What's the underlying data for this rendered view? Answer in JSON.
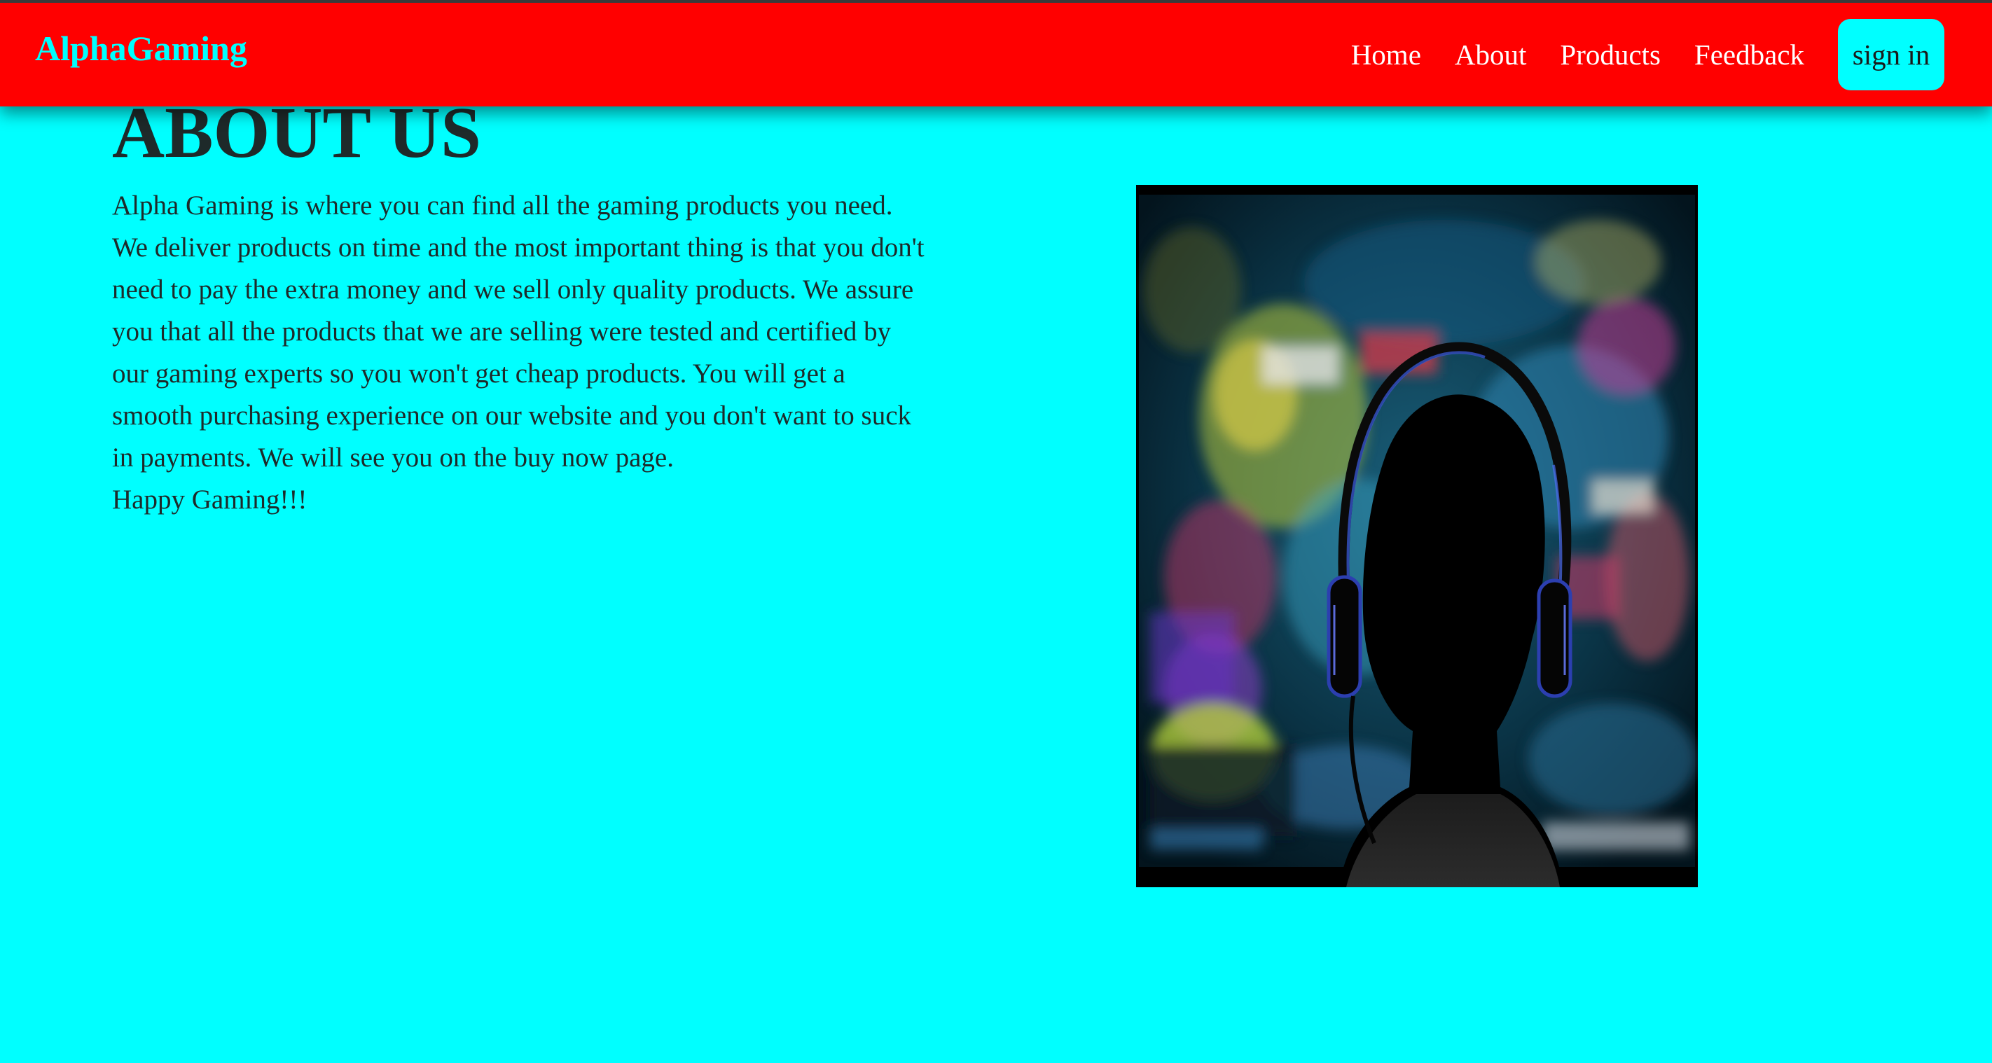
{
  "navbar": {
    "brand": "AlphaGaming",
    "links": [
      "Home",
      "About",
      "Products",
      "Feedback"
    ],
    "signin_label": "sign in"
  },
  "about": {
    "title": "ABOUT US",
    "paragraph": "Alpha Gaming is where you can find all the gaming products you need. We deliver products on time and the most important thing is that you don't need to pay the extra money and we sell only quality products. We assure you that all the products that we are selling were tested and certified by our gaming experts so you won't get cheap products. You will get a smooth purchasing experience on our website and you don't want to suck in payments. We will see you on the buy now page.",
    "closing": "Happy Gaming!!!"
  },
  "image": {
    "subject": "gamer with headphones in front of a blurred game screen"
  },
  "colors": {
    "navbar_bg": "#ff0000",
    "page_bg": "#00ffff",
    "brand_text": "#00ffff",
    "nav_text": "#ffffff",
    "signin_bg": "#00ffff",
    "body_text": "#1e2a2a"
  },
  "icons": [
    "gamer-photo"
  ]
}
